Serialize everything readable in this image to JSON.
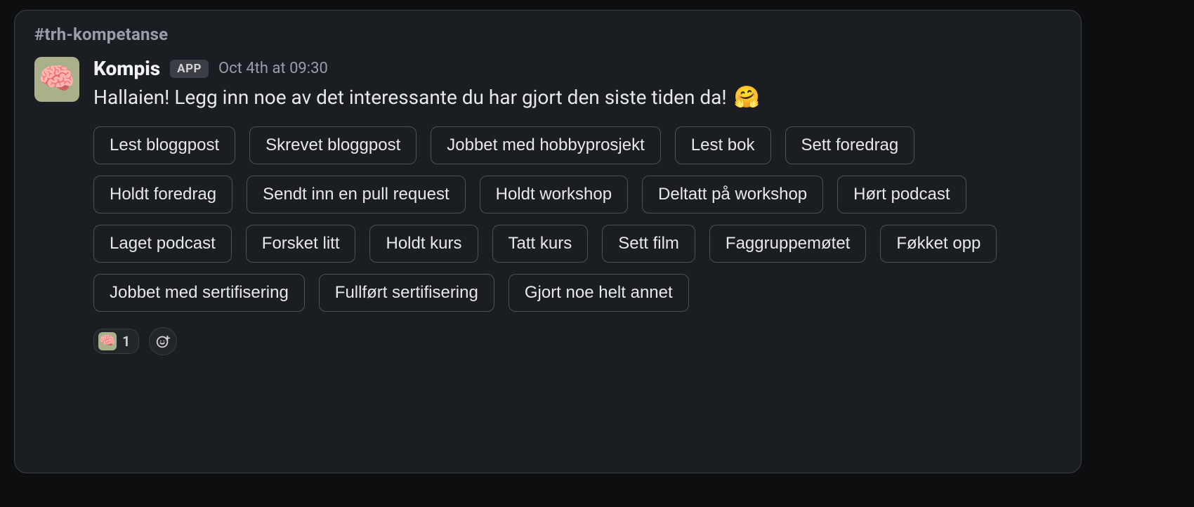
{
  "channel": "#trh-kompetanse",
  "author": "Kompis",
  "app_badge": "APP",
  "timestamp": "Oct 4th at 09:30",
  "body_text": "Hallaien! Legg inn noe av det interessante du har gjort den siste tiden da!",
  "body_emoji": "🤗",
  "avatar_emoji": "🧠",
  "buttons": [
    "Lest bloggpost",
    "Skrevet bloggpost",
    "Jobbet med hobbyprosjekt",
    "Lest bok",
    "Sett foredrag",
    "Holdt foredrag",
    "Sendt inn en pull request",
    "Holdt workshop",
    "Deltatt på workshop",
    "Hørt podcast",
    "Laget podcast",
    "Forsket litt",
    "Holdt kurs",
    "Tatt kurs",
    "Sett film",
    "Faggruppemøtet",
    "Føkket opp",
    "Jobbet med sertifisering",
    "Fullført sertifisering",
    "Gjort noe helt annet"
  ],
  "reaction": {
    "emoji": "🧠",
    "count": "1"
  }
}
